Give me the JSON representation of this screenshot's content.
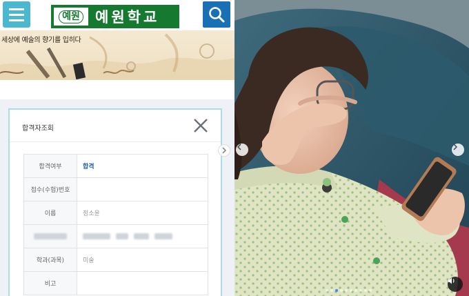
{
  "left_panel": {
    "header": {
      "menu_icon": "hamburger-menu-icon",
      "logo_mark": "예원",
      "logo_name": "예원학교",
      "search_icon": "search-icon",
      "colors": {
        "menu": "#4bb8cf",
        "logo": "#157a30",
        "search": "#1a70b4"
      }
    },
    "banner": {
      "text": "세상에 예술의 향기를 입히다"
    },
    "modal": {
      "title": "합격자조회",
      "close_icon": "close-icon",
      "rows": [
        {
          "label": "합격여부",
          "value": "합격"
        },
        {
          "label": "접수(수험)번호",
          "value": ""
        },
        {
          "label": "이름",
          "value": "정소윤"
        },
        {
          "label": "",
          "value": ""
        },
        {
          "label": "학과(과목)",
          "value": "미술"
        },
        {
          "label": "비고",
          "value": ""
        }
      ]
    }
  },
  "right_panel": {
    "prev_icon": "chevron-left-icon",
    "next_icon": "chevron-right-icon",
    "sound_icon": "speaker-icon",
    "carousel": {
      "count": 10,
      "active": 2
    }
  }
}
